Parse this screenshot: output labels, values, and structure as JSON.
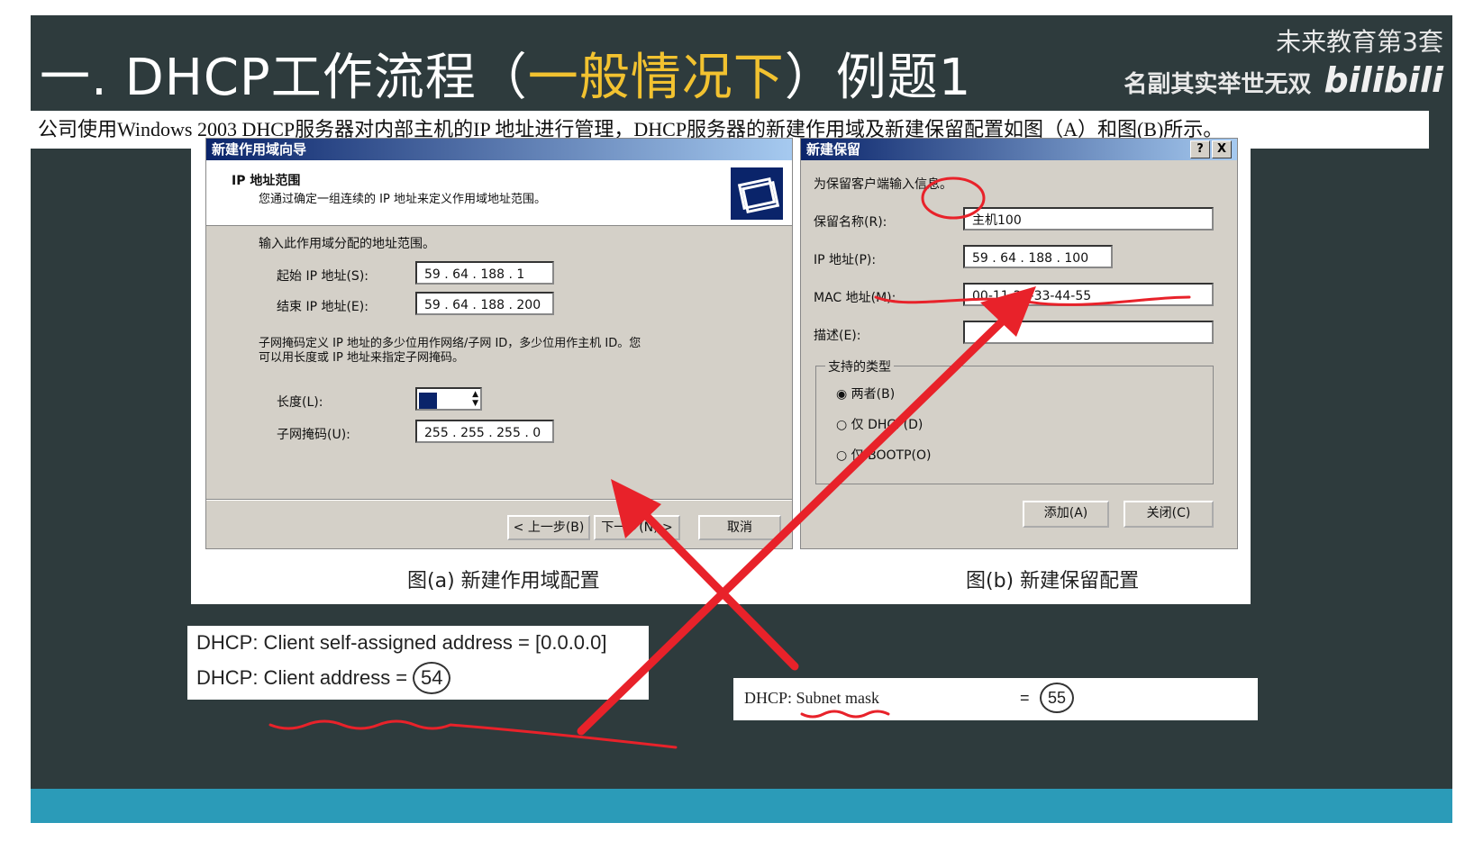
{
  "slide": {
    "title_prefix": "一. DHCP工作流程（",
    "title_highlight": "一般情况下",
    "title_suffix": "）例题1",
    "brand_line1": "未来教育第3套",
    "brand_line2": "名副其实举世无双",
    "brand_logo": "bilibili",
    "question": "公司使用Windows 2003 DHCP服务器对内部主机的IP 地址进行管理，DHCP服务器的新建作用域及新建保留配置如图（A）和图(B)所示。"
  },
  "dialog_a": {
    "title": "新建作用域向导",
    "header_title": "IP 地址范围",
    "header_desc": "您通过确定一组连续的 IP 地址来定义作用域地址范围。",
    "range_prompt": "输入此作用域分配的地址范围。",
    "start_label": "起始 IP 地址(S):",
    "start_value": "59 . 64 . 188 . 1",
    "end_label": "结束 IP 地址(E):",
    "end_value": "59 . 64 . 188 . 200",
    "mask_desc1": "子网掩码定义 IP 地址的多少位用作网络/子网 ID，多少位用作主机 ID。您",
    "mask_desc2": "可以用长度或 IP 地址来指定子网掩码。",
    "length_label": "长度(L):",
    "length_value": "",
    "mask_label": "子网掩码(U):",
    "mask_value": "255 . 255 . 255 . 0",
    "back_btn": "< 上一步(B)",
    "next_btn": "下一步(N) >",
    "cancel_btn": "取消",
    "caption": "图(a)    新建作用域配置"
  },
  "dialog_b": {
    "title": "新建保留",
    "help_btn": "?",
    "close_btn": "X",
    "prompt": "为保留客户端输入信息。",
    "name_label": "保留名称(R):",
    "name_value": "主机100",
    "ip_label": "IP 地址(P):",
    "ip_value": "59 . 64 . 188 . 100",
    "mac_label": "MAC 地址(M):",
    "mac_value": "00-11-22-33-44-55",
    "desc_label": "描述(E):",
    "desc_value": "",
    "group_label": "支持的类型",
    "opt_both": "两者(B)",
    "opt_dhcp": "仅 DHCP(D)",
    "opt_bootp": "仅 BOOTP(O)",
    "add_btn": "添加(A)",
    "close_btn2": "关闭(C)",
    "caption": "图(b)  新建保留配置"
  },
  "snippet_left": {
    "line1": "DHCP: Client self-assigned address  = [0.0.0.0]",
    "line2_label": "DHCP: Client address  =",
    "line2_value": "54"
  },
  "snippet_right": {
    "label": "DHCP: Subnet mask",
    "eq": "=",
    "value": "55"
  },
  "colors": {
    "slide_bg": "#2e3b3d",
    "highlight": "#f2c230",
    "annotation_red": "#e8222a",
    "footer": "#2b9bb8"
  }
}
